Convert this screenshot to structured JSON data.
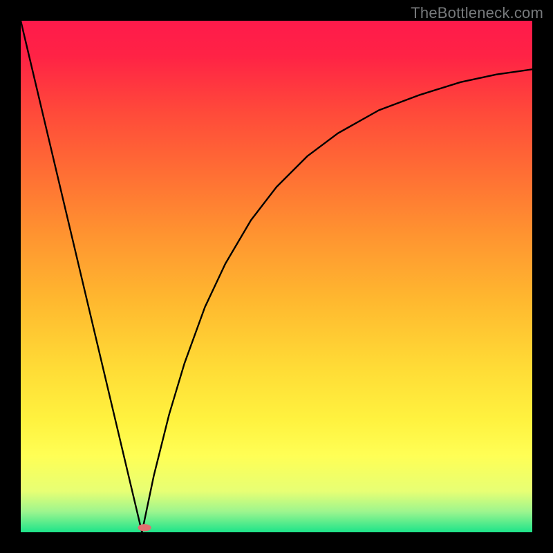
{
  "watermark": {
    "text": "TheBottleneck.com"
  },
  "chart_data": {
    "type": "line",
    "title": "",
    "xlabel": "",
    "ylabel": "",
    "xlim": [
      0,
      1
    ],
    "ylim": [
      0,
      1
    ],
    "background_gradient": {
      "stops": [
        {
          "offset": 0.0,
          "color": "#ff1a4b"
        },
        {
          "offset": 0.07,
          "color": "#ff2345"
        },
        {
          "offset": 0.18,
          "color": "#ff4a3a"
        },
        {
          "offset": 0.3,
          "color": "#ff6f34"
        },
        {
          "offset": 0.42,
          "color": "#ff9430"
        },
        {
          "offset": 0.55,
          "color": "#ffb92f"
        },
        {
          "offset": 0.68,
          "color": "#ffdc36"
        },
        {
          "offset": 0.78,
          "color": "#fff23f"
        },
        {
          "offset": 0.85,
          "color": "#ffff55"
        },
        {
          "offset": 0.92,
          "color": "#e7ff74"
        },
        {
          "offset": 0.96,
          "color": "#9cf58e"
        },
        {
          "offset": 1.0,
          "color": "#1de48a"
        }
      ]
    },
    "series": [
      {
        "name": "left-branch",
        "description": "Near-linear descending segment from top-left toward the minimum",
        "x": [
          0.0,
          0.05,
          0.1,
          0.15,
          0.2,
          0.237
        ],
        "y": [
          1.0,
          0.789,
          0.578,
          0.367,
          0.156,
          0.0
        ]
      },
      {
        "name": "right-branch",
        "description": "Curve rising from the minimum with decreasing slope toward the right edge",
        "x": [
          0.237,
          0.26,
          0.29,
          0.32,
          0.36,
          0.4,
          0.45,
          0.5,
          0.56,
          0.62,
          0.7,
          0.78,
          0.86,
          0.93,
          1.0
        ],
        "y": [
          0.0,
          0.11,
          0.23,
          0.33,
          0.44,
          0.525,
          0.61,
          0.675,
          0.735,
          0.78,
          0.825,
          0.855,
          0.88,
          0.895,
          0.905
        ]
      }
    ],
    "marker": {
      "cx": 0.242,
      "cy": 0.009,
      "rx": 0.013,
      "ry": 0.007,
      "color": "#e07070"
    }
  }
}
